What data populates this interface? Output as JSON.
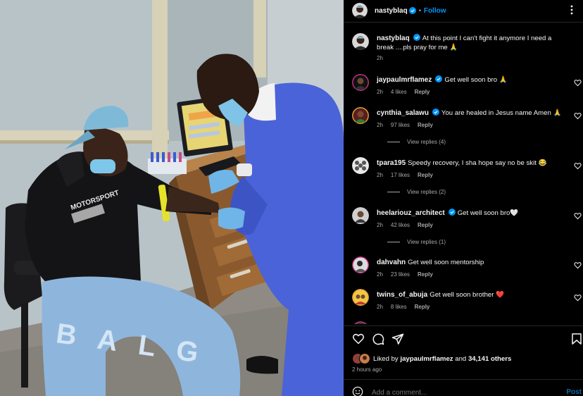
{
  "post": {
    "author": "nastyblaq",
    "follow_label": "Follow",
    "dot": "•",
    "caption": "At this point I can't fight it anymore I need a break ....pls pray for me 🙏",
    "caption_time": "2h"
  },
  "comments": [
    {
      "user": "jaypaulmrflamez",
      "verified": true,
      "text": "Get well soon bro 🙏",
      "time": "2h",
      "likes": "4 likes",
      "reply": "Reply",
      "view_replies": ""
    },
    {
      "user": "cynthia_salawu",
      "verified": true,
      "text": "You are healed in Jesus name Amen 🙏",
      "time": "2h",
      "likes": "97 likes",
      "reply": "Reply",
      "view_replies": "View replies (4)"
    },
    {
      "user": "tpara195",
      "verified": false,
      "text": "Speedy recovery, I sha hope say no be skit 😂",
      "time": "2h",
      "likes": "17 likes",
      "reply": "Reply",
      "view_replies": "View replies (2)"
    },
    {
      "user": "heelariouz_architect",
      "verified": true,
      "text": "Get well soon bro🤍",
      "time": "2h",
      "likes": "42 likes",
      "reply": "Reply",
      "view_replies": "View replies (1)"
    },
    {
      "user": "dahvahn",
      "verified": false,
      "text": "Get well soon mentorship",
      "time": "2h",
      "likes": "23 likes",
      "reply": "Reply",
      "view_replies": ""
    },
    {
      "user": "twins_of_abuja",
      "verified": false,
      "text": "Get well soon brother ❤️",
      "time": "2h",
      "likes": "8 likes",
      "reply": "Reply",
      "view_replies": ""
    }
  ],
  "likes": {
    "prefix": "Liked by",
    "user": "jaypaulmrflamez",
    "middle": "and",
    "others": "34,141 others"
  },
  "time_ago": "2 hours ago",
  "add_comment": {
    "placeholder": "Add a comment...",
    "post_label": "Post"
  },
  "photo": {
    "hoodie_text": "MOTORSPORT",
    "jeans_text": "BALG"
  },
  "icons": {
    "verified": "verified-badge-icon",
    "more": "more-options-icon",
    "like": "heart-icon",
    "comment": "comment-icon",
    "share": "share-icon",
    "save": "bookmark-icon",
    "emoji": "emoji-icon"
  },
  "colors": {
    "background": "#000000",
    "accent": "#0095f6",
    "verified": "#0095f6",
    "muted_text": "#a8a8a8",
    "divider": "#262626",
    "post_button": "#0d6aa6"
  }
}
